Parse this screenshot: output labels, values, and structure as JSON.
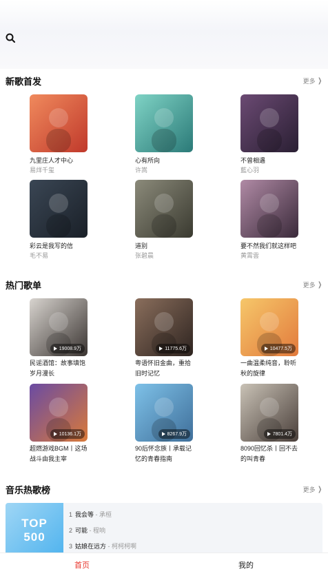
{
  "new_songs": {
    "title": "新歌首发",
    "more": "更多",
    "items": [
      {
        "title": "九里庄人才中心",
        "artist": "易烊千玺",
        "colors": [
          "#f08a5d",
          "#c0392b"
        ]
      },
      {
        "title": "心有所向",
        "artist": "许嵩",
        "colors": [
          "#7fd3c5",
          "#2b7a78"
        ]
      },
      {
        "title": "不曾相遇",
        "artist": "藍心羽",
        "colors": [
          "#6b4a73",
          "#2a1f33"
        ]
      },
      {
        "title": "彩云是我写的信",
        "artist": "毛不易",
        "colors": [
          "#3a4654",
          "#1a2028"
        ]
      },
      {
        "title": "道别",
        "artist": "张碧晨",
        "colors": [
          "#8b8a7a",
          "#3a3a30"
        ]
      },
      {
        "title": "要不然我们就这样吧",
        "artist": "黄霄雲",
        "colors": [
          "#b08aa5",
          "#3a2a3a"
        ]
      }
    ]
  },
  "hot_playlists": {
    "title": "热门歌单",
    "more": "更多",
    "items": [
      {
        "title": "民谣酒馆：故事填饱岁月漫长",
        "plays": "19008.9万",
        "colors": [
          "#d8d4cf",
          "#3a3431"
        ]
      },
      {
        "title": "粤语怀旧金曲，重拾旧时记忆",
        "plays": "11775.6万",
        "colors": [
          "#8a6e5c",
          "#2e2420"
        ]
      },
      {
        "title": "一曲温柔纯音，聆听秋的旋律",
        "plays": "10477.5万",
        "colors": [
          "#f6c76a",
          "#e27a3c"
        ]
      },
      {
        "title": "超燃游戏BGM丨这场战斗由我主宰",
        "plays": "10136.1万",
        "colors": [
          "#6a4ba3",
          "#d97a3a"
        ]
      },
      {
        "title": "90后怀念族丨承载记忆的青春指南",
        "plays": "8267.9万",
        "colors": [
          "#7ec1e8",
          "#3f6f9a"
        ]
      },
      {
        "title": "8090回忆杀丨回不去的叫青春",
        "plays": "7801.4万",
        "colors": [
          "#c9c2b6",
          "#4a3f3a"
        ]
      }
    ]
  },
  "charts": {
    "title": "音乐热歌榜",
    "more": "更多",
    "cover_top": "TOP",
    "cover_num": "500",
    "items": [
      {
        "rank": "1",
        "song": "我会等",
        "artist": "- 承桓"
      },
      {
        "rank": "2",
        "song": "可能",
        "artist": "- 程响"
      },
      {
        "rank": "3",
        "song": "姑娘在远方",
        "artist": "- 柯柯柯啊"
      }
    ]
  },
  "tabbar": {
    "home": "首页",
    "mine": "我的"
  }
}
